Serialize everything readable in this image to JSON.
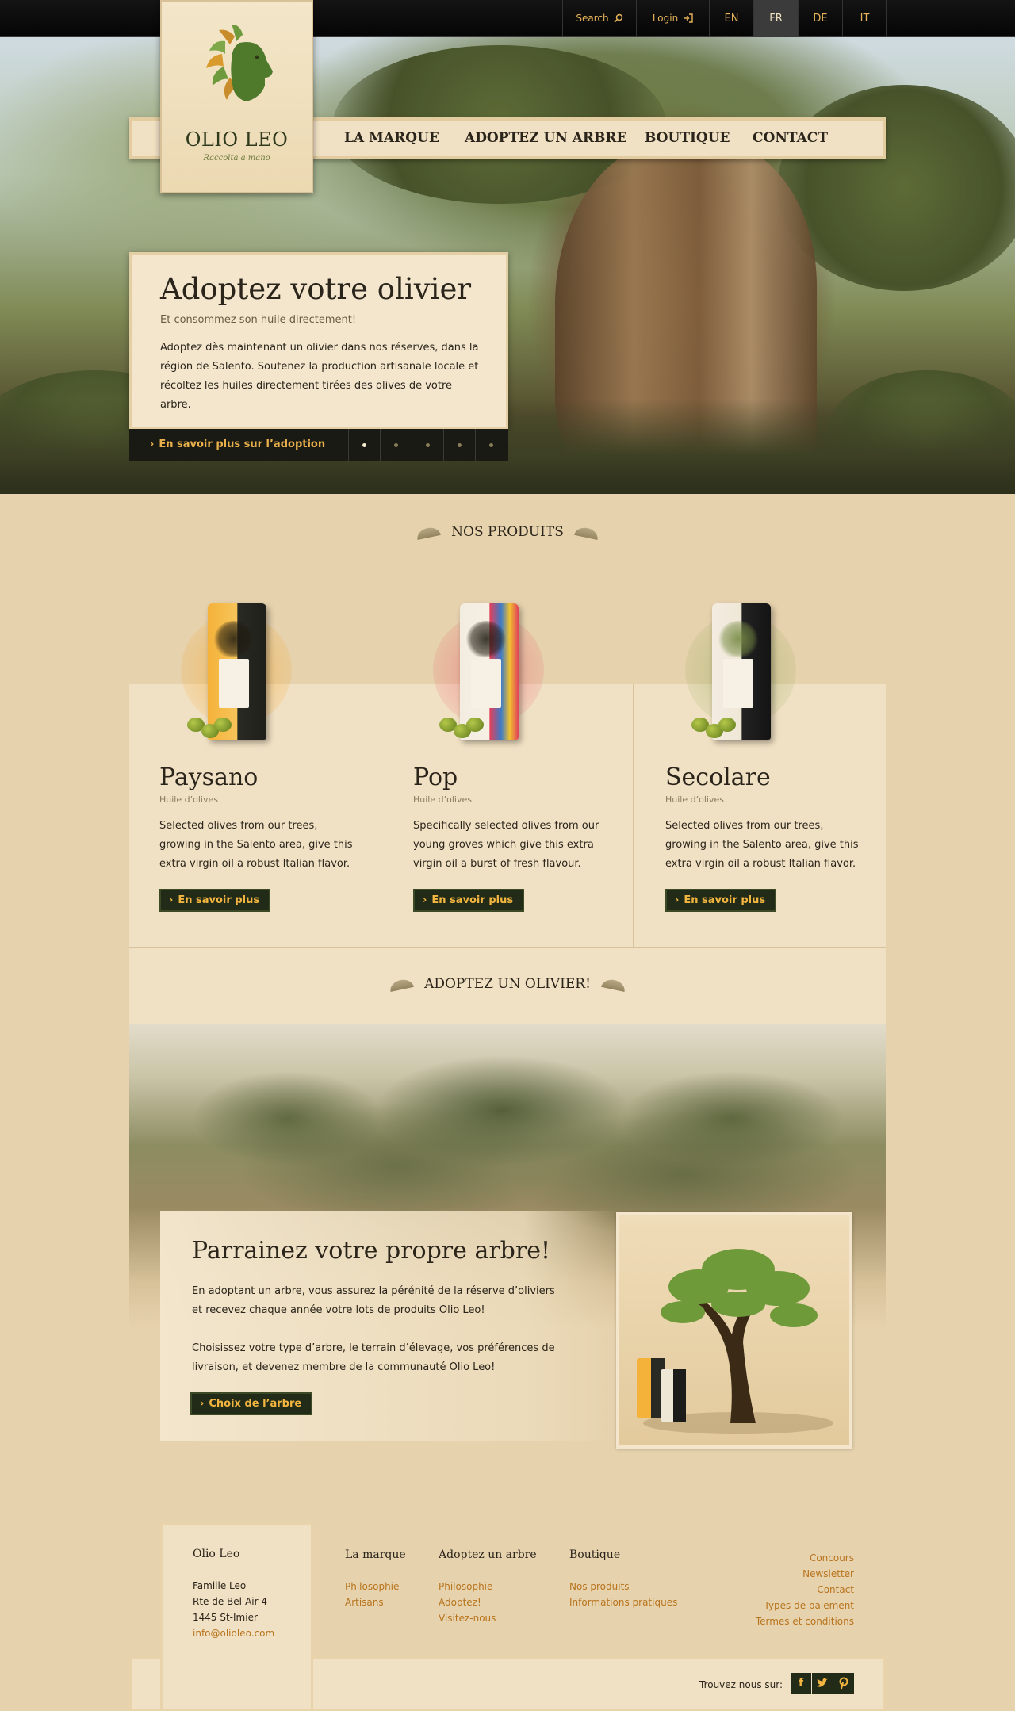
{
  "topbar": {
    "search_label": "Search",
    "login_label": "Login",
    "languages": [
      "EN",
      "FR",
      "DE",
      "IT"
    ],
    "active_language": "FR"
  },
  "brand": {
    "name": "OLIO LEO",
    "tagline": "Raccolta a mano"
  },
  "nav": {
    "items": [
      "LA MARQUE",
      "ADOPTEZ UN ARBRE",
      "BOUTIQUE",
      "CONTACT"
    ]
  },
  "hero": {
    "title": "Adoptez votre olivier",
    "subtitle": "Et consommez son huile directement!",
    "description": "Adoptez dès maintenant un olivier dans nos réserves, dans la région de Salento. Soutenez la production artisanale locale et récoltez les huiles directement tirées des olives de votre arbre.",
    "more_link": "En savoir plus sur l’adoption",
    "slides_total": 5,
    "active_slide": 1
  },
  "products_section": {
    "heading": "NOS PRODUITS",
    "items": [
      {
        "name": "Paysano",
        "type": "Huile d’olives",
        "description": "Selected olives from our trees, growing in the Salento area, give this extra virgin oil a robust Italian flavor.",
        "button": "En savoir plus",
        "color": "#f1a626"
      },
      {
        "name": "Pop",
        "type": "Huile d’olives",
        "description": "Specifically selected olives from our young groves which give this extra virgin oil a burst of fresh flavour.",
        "button": "En savoir plus",
        "color": "#e2405a"
      },
      {
        "name": "Secolare",
        "type": "Huile d’olives",
        "description": "Selected olives from our trees, growing in the Salento area, give this extra virgin oil a robust Italian flavor.",
        "button": "En savoir plus",
        "color": "#1e1e1e"
      }
    ]
  },
  "adopt_section": {
    "heading": "ADOPTEZ UN OLIVIER!",
    "title": "Parrainez votre propre arbre!",
    "paragraph1": "En adoptant un arbre, vous assurez la pérénité de la réserve d’oliviers et recevez chaque année votre lots de produits Olio Leo!",
    "paragraph2": "Choisissez votre type d’arbre, le terrain d’élevage, vos préférences de livraison, et devenez membre de la communauté Olio Leo!",
    "button": "Choix de l’arbre"
  },
  "footer": {
    "company": "Olio Leo",
    "address": [
      "Famille Leo",
      "Rte de Bel-Air 4",
      "1445 St-Imier"
    ],
    "email": "info@olioleo.com",
    "columns": [
      {
        "title": "La marque",
        "links": [
          "Philosophie",
          "Artisans"
        ]
      },
      {
        "title": "Adoptez un arbre",
        "links": [
          "Philosophie",
          "Adoptez!",
          "Visitez-nous"
        ]
      },
      {
        "title": "Boutique",
        "links": [
          "Nos produits",
          "Informations pratiques"
        ]
      }
    ],
    "right_links": [
      "Concours",
      "Newsletter",
      "Contact",
      "Types de paiement",
      "Termes et conditions"
    ],
    "social_label": "Trouvez nous sur:",
    "social_icons": [
      "facebook-icon",
      "twitter-icon",
      "pinterest-icon"
    ]
  },
  "colors": {
    "accent": "#e8b04a",
    "dark_button": "#222a18",
    "panel": "#f1e1c4",
    "page_bg": "#e6d2ad"
  }
}
